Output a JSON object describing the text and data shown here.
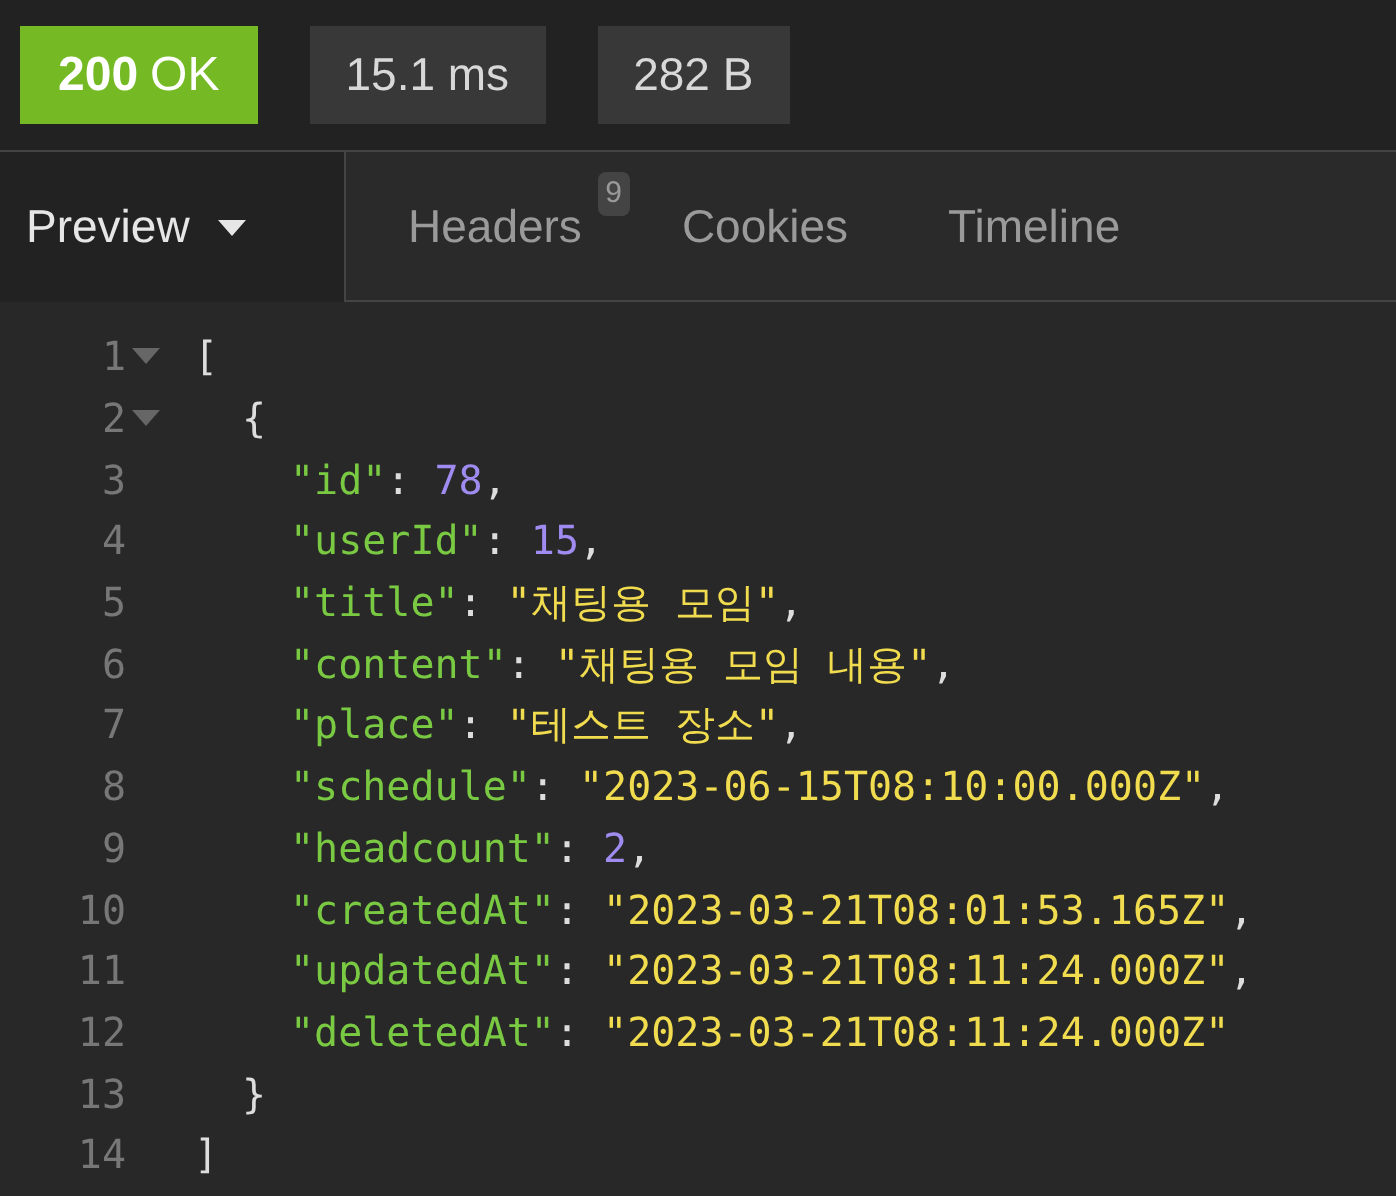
{
  "status_bar": {
    "status": {
      "code": "200",
      "text": "OK",
      "color": "#75ba24"
    },
    "time": "15.1 ms",
    "size": "282 B"
  },
  "tabs": [
    {
      "label": "Preview",
      "selected": true,
      "kind": "dropdown"
    },
    {
      "label": "Headers",
      "selected": false,
      "badge": "9"
    },
    {
      "label": "Cookies",
      "selected": false
    },
    {
      "label": "Timeline",
      "selected": false
    }
  ],
  "code": [
    {
      "number": "1",
      "foldable": true,
      "tokens": [
        {
          "kind": "punct",
          "text": "["
        }
      ],
      "children": [
        {
          "number": "2",
          "foldable": true,
          "tokens": [
            {
              "kind": "punct",
              "text": "{"
            }
          ],
          "children": [
            {
              "number": "3",
              "foldable": false,
              "tokens": [
                {
                  "kind": "key",
                  "text": "\"id\""
                },
                {
                  "kind": "punct",
                  "text": ": "
                },
                {
                  "kind": "number",
                  "text": "78"
                },
                {
                  "kind": "punct",
                  "text": ","
                }
              ]
            },
            {
              "number": "4",
              "foldable": false,
              "tokens": [
                {
                  "kind": "key",
                  "text": "\"userId\""
                },
                {
                  "kind": "punct",
                  "text": ": "
                },
                {
                  "kind": "number",
                  "text": "15"
                },
                {
                  "kind": "punct",
                  "text": ","
                }
              ]
            },
            {
              "number": "5",
              "foldable": false,
              "tokens": [
                {
                  "kind": "key",
                  "text": "\"title\""
                },
                {
                  "kind": "punct",
                  "text": ": "
                },
                {
                  "kind": "string",
                  "text": "\"채팅용 모임\""
                },
                {
                  "kind": "punct",
                  "text": ","
                }
              ]
            },
            {
              "number": "6",
              "foldable": false,
              "tokens": [
                {
                  "kind": "key",
                  "text": "\"content\""
                },
                {
                  "kind": "punct",
                  "text": ": "
                },
                {
                  "kind": "string",
                  "text": "\"채팅용 모임 내용\""
                },
                {
                  "kind": "punct",
                  "text": ","
                }
              ]
            },
            {
              "number": "7",
              "foldable": false,
              "tokens": [
                {
                  "kind": "key",
                  "text": "\"place\""
                },
                {
                  "kind": "punct",
                  "text": ": "
                },
                {
                  "kind": "string",
                  "text": "\"테스트 장소\""
                },
                {
                  "kind": "punct",
                  "text": ","
                }
              ]
            },
            {
              "number": "8",
              "foldable": false,
              "tokens": [
                {
                  "kind": "key",
                  "text": "\"schedule\""
                },
                {
                  "kind": "punct",
                  "text": ": "
                },
                {
                  "kind": "string",
                  "text": "\"2023-06-15T08:10:00.000Z\""
                },
                {
                  "kind": "punct",
                  "text": ","
                }
              ]
            },
            {
              "number": "9",
              "foldable": false,
              "tokens": [
                {
                  "kind": "key",
                  "text": "\"headcount\""
                },
                {
                  "kind": "punct",
                  "text": ": "
                },
                {
                  "kind": "number",
                  "text": "2"
                },
                {
                  "kind": "punct",
                  "text": ","
                }
              ]
            },
            {
              "number": "10",
              "foldable": false,
              "tokens": [
                {
                  "kind": "key",
                  "text": "\"createdAt\""
                },
                {
                  "kind": "punct",
                  "text": ": "
                },
                {
                  "kind": "string",
                  "text": "\"2023-03-21T08:01:53.165Z\""
                },
                {
                  "kind": "punct",
                  "text": ","
                }
              ]
            },
            {
              "number": "11",
              "foldable": false,
              "tokens": [
                {
                  "kind": "key",
                  "text": "\"updatedAt\""
                },
                {
                  "kind": "punct",
                  "text": ": "
                },
                {
                  "kind": "string",
                  "text": "\"2023-03-21T08:11:24.000Z\""
                },
                {
                  "kind": "punct",
                  "text": ","
                }
              ]
            },
            {
              "number": "12",
              "foldable": false,
              "tokens": [
                {
                  "kind": "key",
                  "text": "\"deletedAt\""
                },
                {
                  "kind": "punct",
                  "text": ": "
                },
                {
                  "kind": "string",
                  "text": "\"2023-03-21T08:11:24.000Z\""
                }
              ]
            }
          ]
        },
        {
          "number": "13",
          "foldable": false,
          "tokens": [
            {
              "kind": "punct",
              "text": "}"
            }
          ]
        }
      ]
    },
    {
      "number": "14",
      "foldable": false,
      "tokens": [
        {
          "kind": "punct",
          "text": "]"
        }
      ]
    }
  ]
}
